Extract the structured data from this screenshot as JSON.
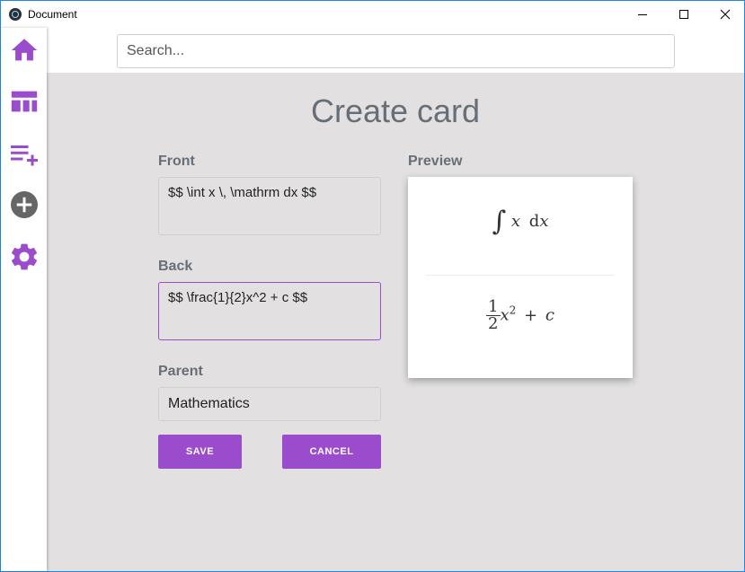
{
  "window": {
    "title": "Document"
  },
  "search": {
    "placeholder": "Search..."
  },
  "sidebar": {
    "items": [
      {
        "name": "home",
        "icon": "home-icon"
      },
      {
        "name": "dashboard",
        "icon": "dashboard-icon"
      },
      {
        "name": "playlist-add",
        "icon": "playlist-add-icon"
      },
      {
        "name": "add",
        "icon": "add-circle-icon"
      },
      {
        "name": "settings",
        "icon": "gear-icon"
      }
    ],
    "accent": "#9b4ccc"
  },
  "page": {
    "title": "Create card"
  },
  "form": {
    "front": {
      "label": "Front",
      "value": "$$ \\int x \\, \\mathrm dx $$"
    },
    "back": {
      "label": "Back",
      "value": "$$ \\frac{1}{2}x^2 + c $$"
    },
    "parent": {
      "label": "Parent",
      "value": "Mathematics"
    },
    "save_label": "SAVE",
    "cancel_label": "CANCEL"
  },
  "preview": {
    "label": "Preview",
    "front_math": {
      "integral": "∫",
      "var": "x",
      "d": "d",
      "dvar": "x"
    },
    "back_math": {
      "num": "1",
      "den": "2",
      "var": "x",
      "exp": "2",
      "plus": "+",
      "c": "c"
    }
  },
  "colors": {
    "accent": "#9b4ccc",
    "background": "#e2e0e0",
    "label": "#666e78"
  }
}
